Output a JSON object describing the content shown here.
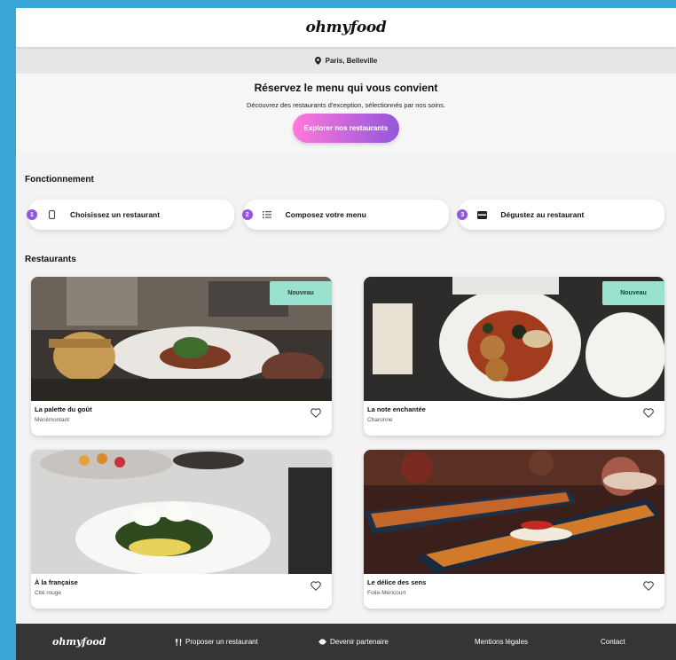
{
  "header": {
    "logo": "ohmyfood"
  },
  "location": {
    "icon": "map-pin-icon",
    "text": "Paris, Belleville"
  },
  "hero": {
    "title": "Réservez le menu qui vous convient",
    "subtitle": "Découvrez des restaurants d'exception, sélectionnés par nos soins.",
    "cta_label": "Explorer nos restaurants"
  },
  "how_it_works": {
    "title": "Fonctionnement",
    "steps": [
      {
        "number": "1",
        "icon": "phone-icon",
        "label": "Choisissez un restaurant"
      },
      {
        "number": "2",
        "icon": "list-icon",
        "label": "Composez votre menu"
      },
      {
        "number": "3",
        "icon": "dish-icon",
        "label": "Dégustez au restaurant"
      }
    ]
  },
  "restaurants": {
    "title": "Restaurants",
    "cards": [
      {
        "name": "La palette du goût",
        "area": "Ménilmontant",
        "badge": "Nouveau"
      },
      {
        "name": "La note enchantée",
        "area": "Charonne",
        "badge": "Nouveau"
      },
      {
        "name": "À la française",
        "area": "Cité rouge",
        "badge": ""
      },
      {
        "name": "Le délice des sens",
        "area": "Folie-Méricourt",
        "badge": ""
      }
    ]
  },
  "footer": {
    "logo": "ohmyfood",
    "links": [
      {
        "icon": "utensils-icon",
        "label": "Proposer un restaurant"
      },
      {
        "icon": "handshake-icon",
        "label": "Devenir partenaire"
      },
      {
        "icon": "",
        "label": "Mentions légales"
      },
      {
        "icon": "",
        "label": "Contact"
      }
    ]
  },
  "colors": {
    "accent_gradient_start": "#ff79da",
    "accent_gradient_end": "#9356dc",
    "badge_bg": "#99e2d0",
    "footer_bg": "#353535",
    "frame_bg": "#3aa6d6"
  }
}
